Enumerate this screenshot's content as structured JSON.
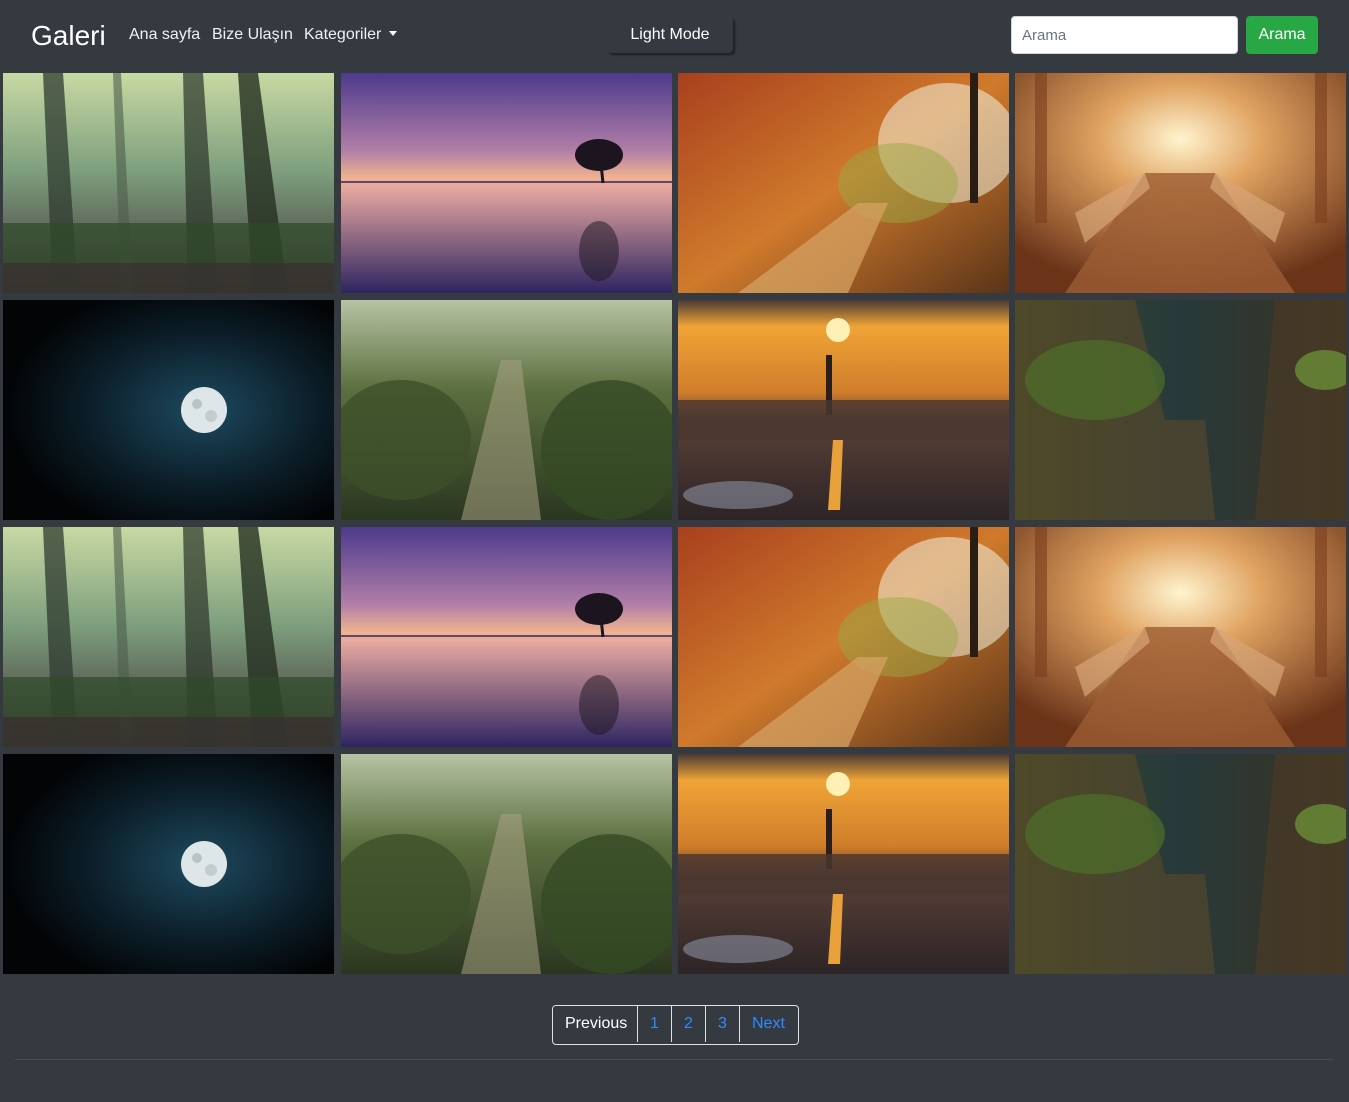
{
  "navbar": {
    "brand": "Galeri",
    "links": [
      "Ana sayfa",
      "Bize Ulaşın",
      "Kategoriler"
    ],
    "mode_button": "Light Mode",
    "search": {
      "placeholder": "Arama",
      "button": "Arama"
    }
  },
  "gallery": {
    "images": [
      "misty-forest",
      "purple-lake-sunset",
      "autumn-forest-path",
      "golden-bridge",
      "full-moon",
      "jungle-path",
      "city-sunset",
      "green-canyon",
      "misty-forest",
      "purple-lake-sunset",
      "autumn-forest-path",
      "golden-bridge",
      "full-moon",
      "jungle-path",
      "city-sunset",
      "green-canyon"
    ]
  },
  "pagination": {
    "previous": "Previous",
    "pages": [
      "1",
      "2",
      "3"
    ],
    "next": "Next"
  },
  "colors": {
    "background": "#343a40",
    "accent_green": "#28a745",
    "link_blue": "#2f8cff"
  }
}
